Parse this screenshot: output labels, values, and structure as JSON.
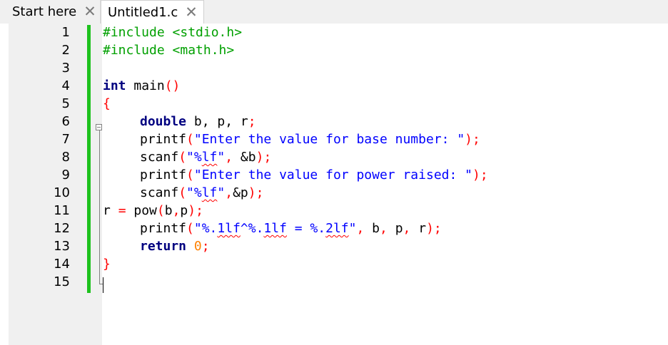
{
  "tabs": [
    {
      "label": "Start here",
      "active": false
    },
    {
      "label": "Untitled1.c",
      "active": true
    }
  ],
  "editor": {
    "line_numbers": [
      "1",
      "2",
      "3",
      "4",
      "5",
      "6",
      "7",
      "8",
      "9",
      "10",
      "11",
      "12",
      "13",
      "14",
      "15"
    ],
    "code": {
      "l1": "#include <stdio.h>",
      "l2": "#include <math.h>",
      "l4_kw": "int",
      "l4_rest": " main",
      "l4_paren": "()",
      "l5_brace": "{",
      "l6_kw": "double",
      "l6_rest": " b, p, r",
      "l6_semi": ";",
      "l7_fn": "printf",
      "l7_open": "(",
      "l7_str": "\"Enter the value for base number: \"",
      "l7_close": ");",
      "l8_fn": "scanf",
      "l8_open": "(",
      "l8_str1": "\"%",
      "l8_fmt": "lf",
      "l8_str2": "\"",
      "l8_comma": ",",
      "l8_amp": " &b",
      "l8_close": ");",
      "l9_fn": "printf",
      "l9_open": "(",
      "l9_str": "\"Enter the value for power raised: \"",
      "l9_close": ");",
      "l10_fn": "scanf",
      "l10_open": "(",
      "l10_str1": "\"%",
      "l10_fmt": "lf",
      "l10_str2": "\"",
      "l10_comma": ",",
      "l10_amp": "&p",
      "l10_close": ");",
      "l11_r": "r ",
      "l11_eq": "=",
      "l11_fn": " pow",
      "l11_open": "(",
      "l11_args_b": "b",
      "l11_comma": ",",
      "l11_args_p": "p",
      "l11_close": ");",
      "l12_fn": "printf",
      "l12_open": "(",
      "l12_s1": "\"%.",
      "l12_f1": "1lf",
      "l12_s2": "^%.",
      "l12_f2": "1lf",
      "l12_s3": " = %.",
      "l12_f3": "2lf",
      "l12_s4": "\"",
      "l12_c1": ",",
      "l12_b": " b",
      "l12_c2": ",",
      "l12_p": " p",
      "l12_c3": ",",
      "l12_r": " r",
      "l12_close": ");",
      "l13_kw": "return",
      "l13_num": " 0",
      "l13_semi": ";",
      "l14_brace": "}"
    }
  },
  "colors": {
    "preprocessor": "#00a000",
    "keyword": "#000080",
    "string": "#0000ff",
    "operator": "#ff0000",
    "number": "#ff8000",
    "change_bar": "#1ec21e"
  },
  "icons": [
    "close-icon",
    "fold-minus-icon"
  ]
}
